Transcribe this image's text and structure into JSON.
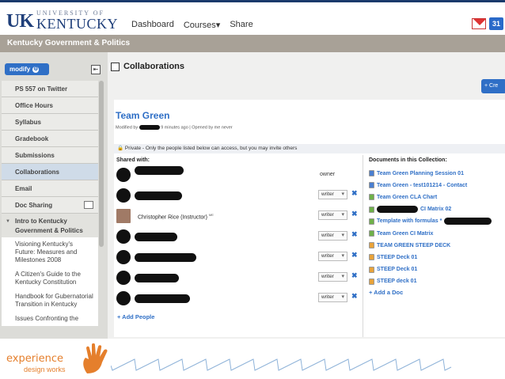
{
  "colors": {
    "accent": "#2f6fc6",
    "brand_navy": "#1f3f7a",
    "course_bar": "#a8a197",
    "footer_orange": "#e57f2c"
  },
  "header": {
    "logo_mark": "UK",
    "logo_small": "UNIVERSITY OF",
    "logo_big": "KENTUCKY",
    "nav": [
      "Dashboard",
      "Courses",
      "Share"
    ],
    "courses_dropdown": "▾",
    "gmail_icon": "gmail-icon",
    "calendar_label": "31"
  },
  "course_bar": {
    "title": "Kentucky Government & Politics"
  },
  "sidebar": {
    "modify_label": "modify",
    "modify_icon": "⚙",
    "items": [
      {
        "label": "PS 557 on Twitter"
      },
      {
        "label": "Office Hours"
      },
      {
        "label": "Syllabus"
      },
      {
        "label": "Gradebook"
      },
      {
        "label": "Submissions"
      },
      {
        "label": "Collaborations",
        "active": true
      },
      {
        "label": "Email"
      },
      {
        "label": "Doc Sharing"
      }
    ],
    "section_label": "Intro to Kentucky Government & Politics",
    "sub_items": [
      "Visioning Kentucky's Future: Measures and Milestones 2008",
      "A Citizen's Guide to the Kentucky Constitution",
      "Handbook for Gubernatorial Transition in Kentucky",
      "Issues Confronting the"
    ]
  },
  "main": {
    "page_title": "Collaborations",
    "create_label": "+ Cre",
    "collab_title": "Team Green",
    "meta_prefix": "Modified by",
    "meta_suffix": "9 minutes ago | Opened by me never",
    "privacy_text": "🔒 Private - Only the people listed below can access, but you may invite others",
    "shared_with_label": "Shared with:",
    "people": [
      {
        "name": "",
        "role": "owner",
        "editable": false
      },
      {
        "name": "",
        "role": "writer",
        "editable": true
      },
      {
        "name": "Christopher Rice (Instructor)",
        "badge": "ME",
        "role": "writer",
        "editable": true
      },
      {
        "name": "",
        "role": "writer",
        "editable": true
      },
      {
        "name": "",
        "role": "writer",
        "editable": true
      },
      {
        "name": "",
        "role": "writer",
        "editable": true
      },
      {
        "name": "",
        "role": "writer",
        "editable": true
      }
    ],
    "remove_symbol": "✖",
    "add_people_label": "+ Add People",
    "docs_label": "Documents in this Collection:",
    "documents": [
      {
        "title": "Team Green Planning Session 01",
        "color": "#4a7fd0"
      },
      {
        "title": "Team Green - test101214 - Contact",
        "color": "#4a7fd0"
      },
      {
        "title": "Team Green CLA Chart",
        "color": "#6fb04a"
      },
      {
        "title": "CI Matrix 02",
        "color": "#6fb04a"
      },
      {
        "title": "Template with formulas *",
        "color": "#6fb04a"
      },
      {
        "title": "Team Green CI Matrix",
        "color": "#6fb04a"
      },
      {
        "title": "TEAM GREEN STEEP DECK",
        "color": "#e8a33b"
      },
      {
        "title": "STEEP Deck 01",
        "color": "#e8a33b"
      },
      {
        "title": "STEEP Deck 01",
        "color": "#e8a33b"
      },
      {
        "title": "STEEP deck 01",
        "color": "#e8a33b"
      }
    ],
    "add_doc_label": "+ Add a Doc"
  },
  "footer": {
    "brand_top": "experience",
    "brand_bottom": "design works"
  }
}
